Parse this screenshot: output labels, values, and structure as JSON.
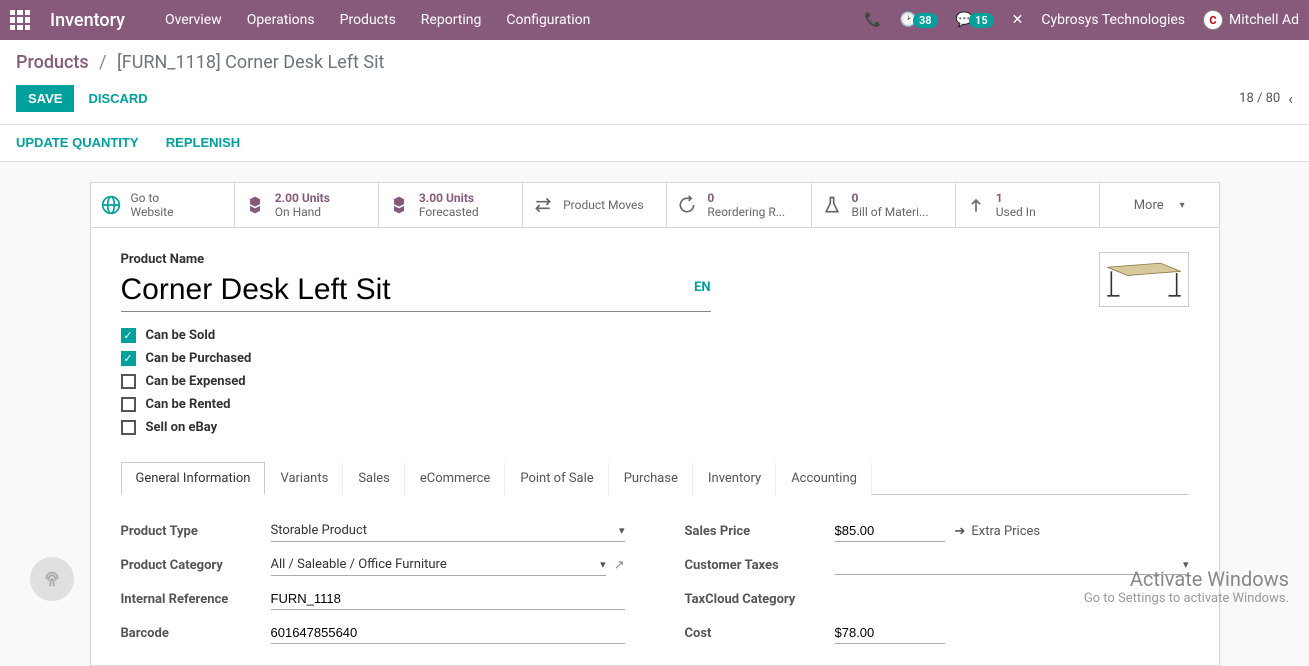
{
  "topnav": {
    "app": "Inventory",
    "menu": [
      "Overview",
      "Operations",
      "Products",
      "Reporting",
      "Configuration"
    ],
    "clock_badge": "38",
    "chat_badge": "15",
    "company": "Cybrosys Technologies",
    "user": "Mitchell Ad"
  },
  "breadcrumb": {
    "root": "Products",
    "current": "[FURN_1118] Corner Desk Left Sit"
  },
  "actions": {
    "save": "SAVE",
    "discard": "DISCARD",
    "pager": "18 / 80",
    "update_qty": "UPDATE QUANTITY",
    "replenish": "REPLENISH"
  },
  "stats": {
    "website": {
      "line1": "Go to",
      "line2": "Website"
    },
    "onhand": {
      "val": "2.00 Units",
      "lbl": "On Hand"
    },
    "forecast": {
      "val": "3.00 Units",
      "lbl": "Forecasted"
    },
    "moves": {
      "lbl": "Product Moves"
    },
    "reorder": {
      "val": "0",
      "lbl": "Reordering R..."
    },
    "bom": {
      "val": "0",
      "lbl": "Bill of Materi..."
    },
    "usedin": {
      "val": "1",
      "lbl": "Used In"
    },
    "more": "More"
  },
  "product": {
    "label": "Product Name",
    "name": "Corner Desk Left Sit",
    "lang": "EN"
  },
  "checks": {
    "sold": "Can be Sold",
    "purchased": "Can be Purchased",
    "expensed": "Can be Expensed",
    "rented": "Can be Rented",
    "ebay": "Sell on eBay"
  },
  "tabs": [
    "General Information",
    "Variants",
    "Sales",
    "eCommerce",
    "Point of Sale",
    "Purchase",
    "Inventory",
    "Accounting"
  ],
  "fields": {
    "left": {
      "type_lbl": "Product Type",
      "type_val": "Storable Product",
      "cat_lbl": "Product Category",
      "cat_val": "All / Saleable / Office Furniture",
      "ref_lbl": "Internal Reference",
      "ref_val": "FURN_1118",
      "barcode_lbl": "Barcode",
      "barcode_val": "601647855640"
    },
    "right": {
      "price_lbl": "Sales Price",
      "price_val": "$85.00",
      "extra": "Extra Prices",
      "tax_lbl": "Customer Taxes",
      "taxcloud_lbl": "TaxCloud Category",
      "cost_lbl": "Cost",
      "cost_val": "$78.00"
    }
  },
  "watermark": {
    "t1": "Activate Windows",
    "t2": "Go to Settings to activate Windows."
  }
}
